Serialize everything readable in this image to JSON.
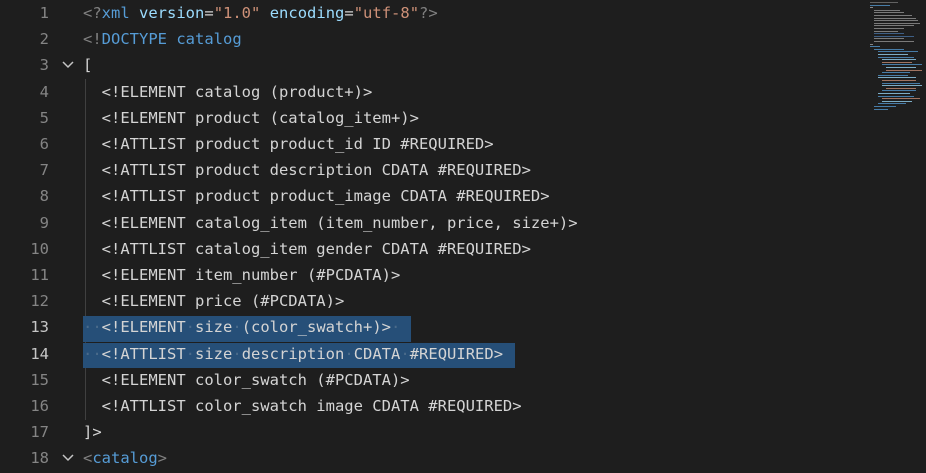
{
  "editor": {
    "line_numbers": [
      "1",
      "2",
      "3",
      "4",
      "5",
      "6",
      "7",
      "8",
      "9",
      "10",
      "11",
      "12",
      "13",
      "14",
      "15",
      "16",
      "17",
      "18"
    ],
    "active_lines": [
      "13",
      "14"
    ],
    "fold_lines": [
      "3",
      "18"
    ],
    "lines": [
      {
        "tokens": [
          {
            "t": "<?",
            "c": "xml"
          },
          {
            "t": "xml",
            "c": "kw"
          },
          {
            "t": " ",
            "c": "plain"
          },
          {
            "t": "version",
            "c": "attr"
          },
          {
            "t": "=",
            "c": "plain"
          },
          {
            "t": "\"1.0\"",
            "c": "str"
          },
          {
            "t": " ",
            "c": "plain"
          },
          {
            "t": "encoding",
            "c": "attr"
          },
          {
            "t": "=",
            "c": "plain"
          },
          {
            "t": "\"utf-8\"",
            "c": "str"
          },
          {
            "t": "?>",
            "c": "xml"
          }
        ]
      },
      {
        "tokens": [
          {
            "t": "<!",
            "c": "xml"
          },
          {
            "t": "DOCTYPE",
            "c": "kw"
          },
          {
            "t": " catalog",
            "c": "kw"
          }
        ]
      },
      {
        "tokens": [
          {
            "t": "[",
            "c": "plain"
          }
        ]
      },
      {
        "tokens": [
          {
            "t": "  <!ELEMENT catalog (product+)>",
            "c": "plain"
          }
        ]
      },
      {
        "tokens": [
          {
            "t": "  <!ELEMENT product (catalog_item+)>",
            "c": "plain"
          }
        ]
      },
      {
        "tokens": [
          {
            "t": "  <!ATTLIST product product_id ID #REQUIRED>",
            "c": "plain"
          }
        ]
      },
      {
        "tokens": [
          {
            "t": "  <!ATTLIST product description CDATA #REQUIRED>",
            "c": "plain"
          }
        ]
      },
      {
        "tokens": [
          {
            "t": "  <!ATTLIST product product_image CDATA #REQUIRED>",
            "c": "plain"
          }
        ]
      },
      {
        "tokens": [
          {
            "t": "  <!ELEMENT catalog_item (item_number, price, size+)>",
            "c": "plain"
          }
        ]
      },
      {
        "tokens": [
          {
            "t": "  <!ATTLIST catalog_item gender CDATA #REQUIRED>",
            "c": "plain"
          }
        ]
      },
      {
        "tokens": [
          {
            "t": "  <!ELEMENT item_number (#PCDATA)>",
            "c": "plain"
          }
        ]
      },
      {
        "tokens": [
          {
            "t": "  <!ELEMENT price (#PCDATA)>",
            "c": "plain"
          }
        ]
      },
      {
        "tokens": [
          {
            "t": "··",
            "c": "ws"
          },
          {
            "t": "<!ELEMENT",
            "c": "plain"
          },
          {
            "t": "·",
            "c": "ws"
          },
          {
            "t": "size",
            "c": "plain"
          },
          {
            "t": "·",
            "c": "ws"
          },
          {
            "t": "(color_swatch+)>",
            "c": "plain"
          },
          {
            "t": "·",
            "c": "ws"
          }
        ]
      },
      {
        "tokens": [
          {
            "t": "··",
            "c": "ws"
          },
          {
            "t": "<!ATTLIST",
            "c": "plain"
          },
          {
            "t": "·",
            "c": "ws"
          },
          {
            "t": "size",
            "c": "plain"
          },
          {
            "t": "·",
            "c": "ws"
          },
          {
            "t": "description",
            "c": "plain"
          },
          {
            "t": "·",
            "c": "ws"
          },
          {
            "t": "CDATA",
            "c": "plain"
          },
          {
            "t": "·",
            "c": "ws"
          },
          {
            "t": "#REQUIRED>",
            "c": "plain"
          }
        ]
      },
      {
        "tokens": [
          {
            "t": "  <!ELEMENT color_swatch (#PCDATA)>",
            "c": "plain"
          }
        ]
      },
      {
        "tokens": [
          {
            "t": "  <!ATTLIST color_swatch image CDATA #REQUIRED>",
            "c": "plain"
          }
        ]
      },
      {
        "tokens": [
          {
            "t": "]>",
            "c": "plain"
          }
        ]
      },
      {
        "tokens": [
          {
            "t": "<",
            "c": "xml"
          },
          {
            "t": "catalog",
            "c": "kw"
          },
          {
            "t": ">",
            "c": "xml"
          }
        ]
      }
    ]
  },
  "colors": {
    "background": "#1e1e1e",
    "selection": "#264f78",
    "line_number": "#858585",
    "line_number_active": "#c6c6c6"
  },
  "icons": {
    "fold": "chevron-down-icon"
  }
}
